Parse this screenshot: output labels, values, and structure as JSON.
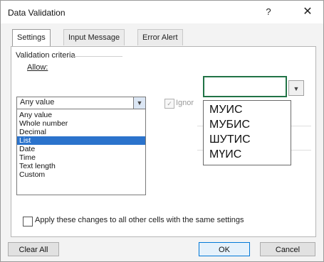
{
  "dialog": {
    "title": "Data Validation",
    "help_label": "?",
    "close_label": "✕"
  },
  "tabs": [
    {
      "label": "Settings"
    },
    {
      "label": "Input Message"
    },
    {
      "label": "Error Alert"
    }
  ],
  "settings": {
    "group_label": "Validation criteria",
    "allow_label": "Allow:",
    "allow_value": "Any value",
    "allow_options": [
      "Any value",
      "Whole number",
      "Decimal",
      "List",
      "Date",
      "Time",
      "Text length",
      "Custom"
    ],
    "selected_option": "List",
    "ignore_label": "Ignor",
    "apply_label": "Apply these changes to all other cells with the same settings"
  },
  "cell_dropdown": {
    "items": [
      "МУИС",
      "МУБИС",
      "ШУТИС",
      "МҮИС"
    ]
  },
  "buttons": {
    "clear_all": "Clear All",
    "ok": "OK",
    "cancel": "Cancel"
  },
  "colors": {
    "selection": "#2b73cc",
    "active_cell_border": "#217346"
  }
}
